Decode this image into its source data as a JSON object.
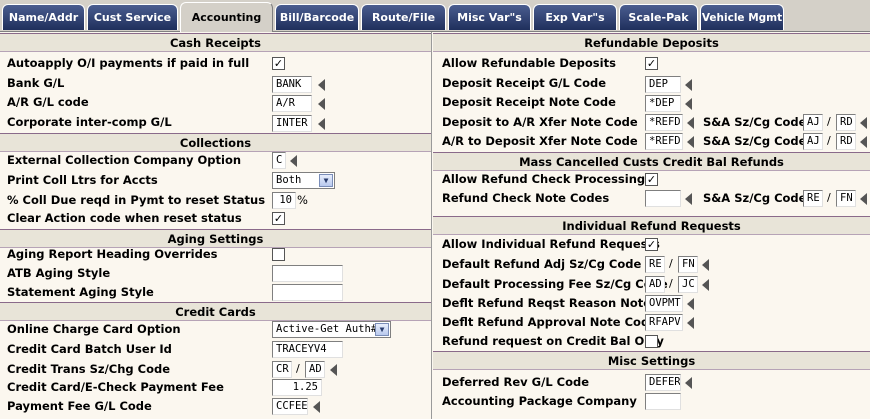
{
  "tabs": [
    {
      "label": "Name/Addr",
      "active": false
    },
    {
      "label": "Cust Service",
      "active": false
    },
    {
      "label": "Accounting",
      "active": true
    },
    {
      "label": "Bill/Barcode",
      "active": false
    },
    {
      "label": "Route/File",
      "active": false
    },
    {
      "label": "Misc Var\"s",
      "active": false
    },
    {
      "label": "Exp Var\"s",
      "active": false
    },
    {
      "label": "Scale-Pak",
      "active": false
    },
    {
      "label": "Vehicle Mgmt",
      "active": false
    }
  ],
  "cash_receipts": {
    "title": "Cash Receipts",
    "autoapply_label": "Autoapply O/I payments if paid in full",
    "autoapply_checked": true,
    "bank_gl_label": "Bank G/L",
    "bank_gl_value": "BANK",
    "ar_gl_label": "A/R G/L code",
    "ar_gl_value": "A/R",
    "corp_intercomp_label": "Corporate inter-comp G/L",
    "corp_intercomp_value": "INTER"
  },
  "collections": {
    "title": "Collections",
    "ext_company_label": "External Collection Company Option",
    "ext_company_value": "C",
    "print_letters_label": "Print Coll Ltrs for Accts",
    "print_letters_value": "Both",
    "pct_due_label": "% Coll Due reqd in Pymt to reset Status",
    "pct_due_value": "10",
    "pct_symbol": "%",
    "clear_action_label": "Clear Action code when reset status",
    "clear_action_checked": true
  },
  "aging": {
    "title": "Aging Settings",
    "heading_overrides_label": "Aging Report Heading Overrides",
    "heading_overrides_checked": false,
    "atb_label": "ATB Aging Style",
    "atb_value": "",
    "statement_label": "Statement Aging Style",
    "statement_value": ""
  },
  "credit_cards": {
    "title": "Credit Cards",
    "online_option_label": "Online Charge Card Option",
    "online_option_value": "Active-Get Auth#",
    "batch_user_label": "Credit Card Batch User Id",
    "batch_user_value": "TRACEYV4",
    "trans_label": "Credit Trans Sz/Chg Code",
    "trans_sz_value": "CR",
    "trans_cg_value": "AD",
    "payment_fee_label": "Credit Card/E-Check Payment Fee",
    "payment_fee_value": "1.25",
    "fee_gl_label": "Payment Fee G/L Code",
    "fee_gl_value": "CCFEE"
  },
  "refundable_deposits": {
    "title": "Refundable Deposits",
    "allow_label": "Allow Refundable Deposits",
    "allow_checked": true,
    "receipt_gl_label": "Deposit Receipt G/L Code",
    "receipt_gl_value": "DEP",
    "receipt_note_label": "Deposit Receipt Note Code",
    "receipt_note_value": "*DEP",
    "to_ar_label": "Deposit to A/R Xfer Note Code",
    "to_ar_value": "*REFD",
    "ar_to_dep_label": "A/R to Deposit Xfer Note Code",
    "ar_to_dep_value": "*REFD",
    "sa_label": "S&A Sz/Cg Code",
    "to_ar_sz": "AJ",
    "to_ar_cg": "RD",
    "ar_to_dep_sz": "AJ",
    "ar_to_dep_cg": "RD"
  },
  "mass_cancelled": {
    "title": "Mass Cancelled Custs Credit Bal Refunds",
    "allow_check_label": "Allow Refund Check Processing",
    "allow_check_checked": true,
    "check_note_label": "Refund Check Note Codes",
    "check_note_value": "",
    "sa_label": "S&A Sz/Cg Code",
    "sz_value": "RE",
    "cg_value": "FN"
  },
  "individual_refund": {
    "title": "Individual Refund Requests",
    "allow_label": "Allow Individual Refund Requests",
    "allow_checked": true,
    "adj_label": "Default Refund Adj Sz/Cg Code",
    "adj_sz": "RE",
    "adj_cg": "FN",
    "fee_label": "Default Processing Fee Sz/Cg Code",
    "fee_sz": "AD",
    "fee_cg": "JC",
    "reason_label": "Deflt Refund Reqst Reason Note Cd",
    "reason_value": "OVPMT",
    "approval_label": "Deflt Refund Approval Note Code",
    "approval_value": "RFAPV",
    "credit_only_label": "Refund request on Credit Bal Only",
    "credit_only_checked": false
  },
  "misc": {
    "title": "Misc Settings",
    "deferred_label": "Deferred Rev G/L Code",
    "deferred_value": "DEFER",
    "package_label": "Accounting Package Company",
    "package_value": ""
  },
  "glyphs": {
    "check": "✓",
    "slash": "/",
    "dropdown": "▼"
  }
}
